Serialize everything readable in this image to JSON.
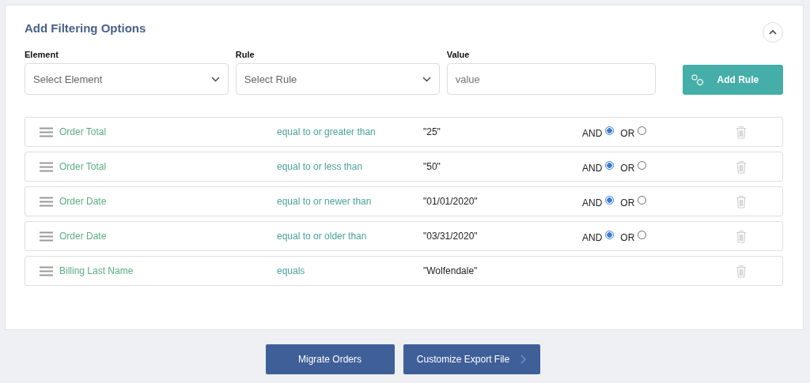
{
  "panel": {
    "title": "Add Filtering Options"
  },
  "form": {
    "fields": [
      {
        "kind": "select",
        "label": "Element",
        "placeholder": "Select Element"
      },
      {
        "kind": "select",
        "label": "Rule",
        "placeholder": "Select Rule"
      },
      {
        "kind": "text",
        "label": "Value",
        "placeholder": "value"
      }
    ],
    "add_button": "Add Rule"
  },
  "rules": [
    {
      "element": "Order Total",
      "rule": "equal to or greater than",
      "value": "\"25\"",
      "connector": [
        {
          "label": "AND",
          "selected": true
        },
        {
          "label": "OR",
          "selected": false
        }
      ]
    },
    {
      "element": "Order Total",
      "rule": "equal to or less than",
      "value": "\"50\"",
      "connector": [
        {
          "label": "AND",
          "selected": true
        },
        {
          "label": "OR",
          "selected": false
        }
      ]
    },
    {
      "element": "Order Date",
      "rule": "equal to or newer than",
      "value": "\"01/01/2020\"",
      "connector": [
        {
          "label": "AND",
          "selected": true
        },
        {
          "label": "OR",
          "selected": false
        }
      ]
    },
    {
      "element": "Order Date",
      "rule": "equal to or older than",
      "value": "\"03/31/2020\"",
      "connector": [
        {
          "label": "AND",
          "selected": true
        },
        {
          "label": "OR",
          "selected": false
        }
      ]
    },
    {
      "element": "Billing Last Name",
      "rule": "equals",
      "value": "\"Wolfendale\""
    }
  ],
  "footer_buttons": [
    {
      "label": "Migrate Orders",
      "chevron": false
    },
    {
      "label": "Customize Export File",
      "chevron": true
    }
  ]
}
